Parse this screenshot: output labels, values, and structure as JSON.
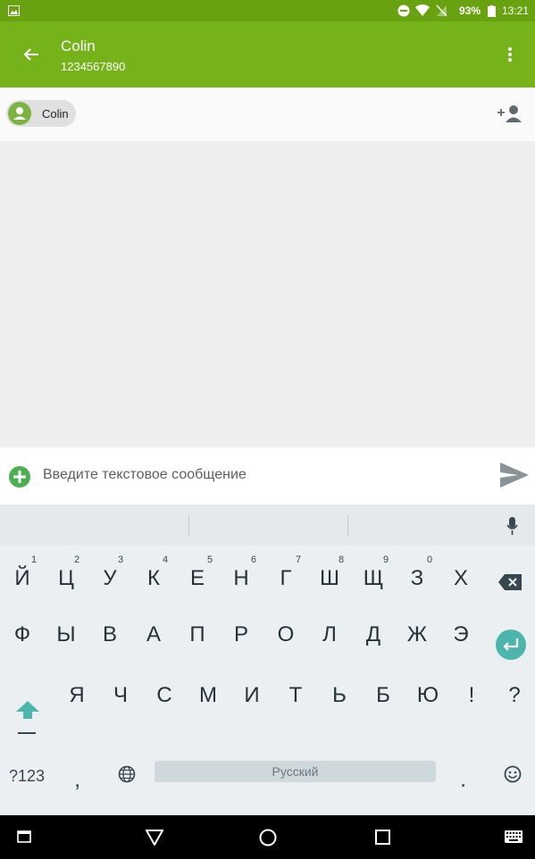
{
  "status_bar": {
    "battery_percent": "93%",
    "time": "13:21"
  },
  "app_bar": {
    "title": "Colin",
    "subtitle": "1234567890"
  },
  "recipients": {
    "chip_label": "Colin"
  },
  "compose": {
    "placeholder": "Введите текстовое сообщение"
  },
  "keyboard": {
    "row1": [
      "Й",
      "Ц",
      "У",
      "К",
      "Е",
      "Н",
      "Г",
      "Ш",
      "Щ",
      "З",
      "Х"
    ],
    "row1_hints": [
      "1",
      "2",
      "3",
      "4",
      "5",
      "6",
      "7",
      "8",
      "9",
      "0"
    ],
    "row2": [
      "Ф",
      "Ы",
      "В",
      "А",
      "П",
      "Р",
      "О",
      "Л",
      "Д",
      "Ж",
      "Э"
    ],
    "row3": [
      "Я",
      "Ч",
      "С",
      "М",
      "И",
      "Т",
      "Ь",
      "Б",
      "Ю",
      "!",
      "?"
    ],
    "row4": {
      "symbols": "?123",
      "comma": ",",
      "space": "Русский",
      "period": "."
    }
  },
  "colors": {
    "accent": "#76b31b",
    "status": "#68a210",
    "enter_key": "#4db6ac"
  }
}
